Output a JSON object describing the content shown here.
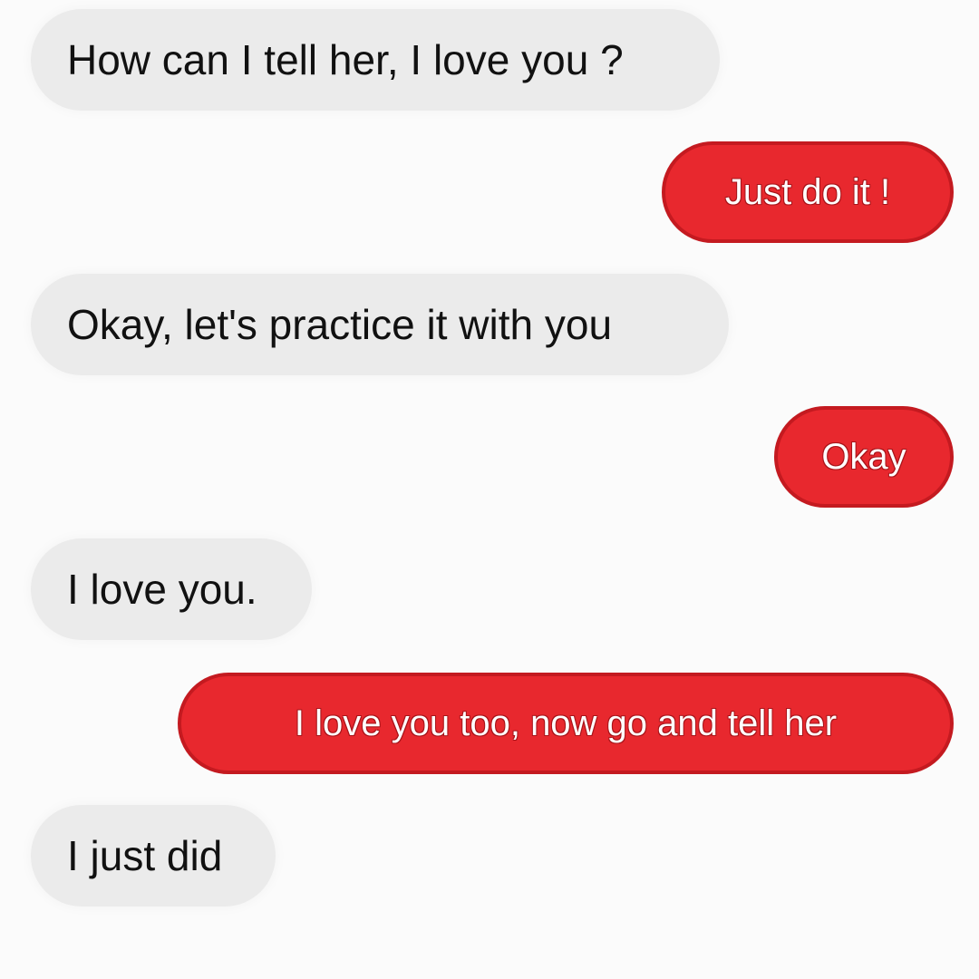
{
  "messages": [
    {
      "from": "them",
      "text": "How can I tell her, I love you ?"
    },
    {
      "from": "me",
      "text": "Just do it !"
    },
    {
      "from": "them",
      "text": "Okay, let's practice it with you"
    },
    {
      "from": "me",
      "text": "Okay"
    },
    {
      "from": "them",
      "text": "I love you."
    },
    {
      "from": "me",
      "text": "I love you too, now go and tell her"
    },
    {
      "from": "them",
      "text": "I just did"
    }
  ],
  "colors": {
    "incoming_bubble": "#ebebeb",
    "outgoing_bubble": "#e8282e",
    "outgoing_text": "#ffffff",
    "incoming_text": "#111111",
    "background": "#fbfbfb"
  }
}
